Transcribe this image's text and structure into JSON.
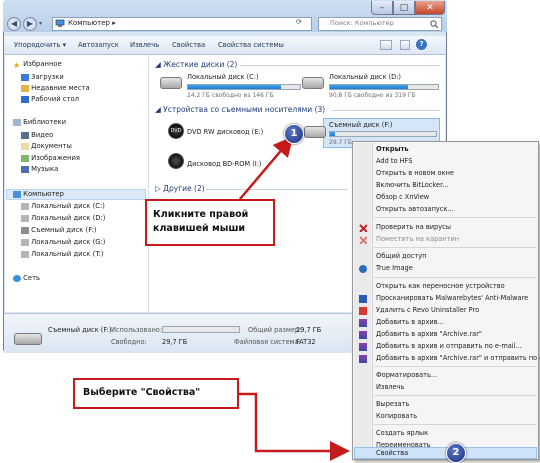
{
  "window": {
    "address": "Компьютер",
    "search_placeholder": "Поиск: Компьютер",
    "controls": {
      "minimize": "–",
      "maximize": "□",
      "close": "✕"
    }
  },
  "toolbar": {
    "organize": "Упорядочить ▾",
    "autoplay": "Автозапуск",
    "eject": "Извлечь",
    "properties": "Свойства",
    "system_properties": "Свойства системы"
  },
  "nav": {
    "favorites": "Избранное",
    "downloads": "Загрузки",
    "recent": "Недавние места",
    "desktop": "Рабочий стол",
    "libraries": "Библиотеки",
    "video": "Видео",
    "documents": "Документы",
    "images": "Изображения",
    "music": "Музыка",
    "computer": "Компьютер",
    "disk_c": "Локальный диск (C:)",
    "disk_d": "Локальный диск (D:)",
    "disk_f": "Съемный диск (F:)",
    "disk_g": "Локальный диск (G:)",
    "disk_t": "Локальный диск (T:)",
    "network": "Сеть"
  },
  "content": {
    "hdd_group": "Жесткие диски (2)",
    "removable_group": "Устройства со съемными носителями (3)",
    "other_group": "Другие (2)",
    "disk_c": {
      "name": "Локальный диск (C:)",
      "free": "24,2 ГБ свободно из 146 ГБ",
      "used_fraction": 0.83
    },
    "disk_d": {
      "name": "Локальный диск (D:)",
      "free": "90,8 ГБ свободно из 319 ГБ",
      "used_fraction": 0.72
    },
    "dvd_e": "DVD RW дисковод (E:)",
    "bd_i": "Дисковод BD-ROM (I:)",
    "disk_f": {
      "name": "Съемный диск (F:)",
      "free": "29,7 ГБ",
      "used_fraction": 0.05
    }
  },
  "details": {
    "name": "Съемный диск (F:)",
    "used_label": "Использовано:",
    "free_label": "Свободно:",
    "free_value": "29,7 ГБ",
    "total_label": "Общий размер:",
    "total_value": "29,7 ГБ",
    "fs_label": "Файловая система:",
    "fs_value": "FAT32"
  },
  "menu": {
    "open": "Открыть",
    "add_hfs": "Add to HFS",
    "open_new_window": "Открыть в новом окне",
    "bitlocker": "Включить BitLocker...",
    "xnview": "Обзор с XnView",
    "autoplay": "Открыть автозапуск...",
    "check_virus": "Проверить на вирусы",
    "quarantine": "Поместить на карантин",
    "share": "Общий доступ",
    "true_image": "True Image",
    "open_portable": "Открыть как переносное устройство",
    "malwarebytes": "Просканировать Malwarebytes' Anti-Malware",
    "revo": "Удалить с Revo Uninstaller Pro",
    "add_archive": "Добавить в архив...",
    "add_archive_rar": "Добавить в архив \"Archive.rar\"",
    "add_email": "Добавить в архив и отправить по e-mail...",
    "add_rar_email": "Добавить в архив \"Archive.rar\" и отправить по e-mail",
    "format": "Форматировать...",
    "eject": "Извлечь",
    "cut": "Вырезать",
    "copy": "Копировать",
    "shortcut": "Создать ярлык",
    "rename": "Переименовать",
    "properties": "Свойства"
  },
  "callouts": {
    "right_click": "Кликните правой клавишей мыши",
    "choose_properties": "Выберите \"Свойства\"",
    "step1": "1",
    "step2": "2"
  },
  "colors": {
    "accent_red": "#c61b1b",
    "badge_blue": "#1c2f80",
    "selection": "#d5e6f8"
  }
}
